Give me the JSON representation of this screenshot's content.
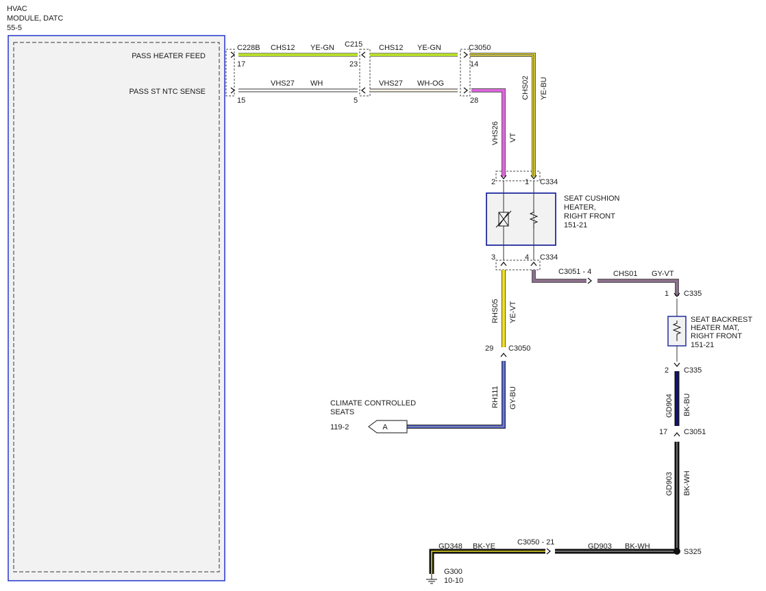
{
  "module": {
    "title_line1": "HVAC",
    "title_line2": "MODULE, DATC",
    "title_line3": "55-5",
    "pin_pass_heater_feed": "PASS HEATER FEED",
    "pin_pass_st_ntc_sense": "PASS ST NTC SENSE"
  },
  "connectors": {
    "c228b": "C228B",
    "c215": "C215",
    "c3050_top": "C3050",
    "c334_top": "C334",
    "c334_bottom": "C334",
    "c3051_4": "C3051  -  4",
    "c335_top": "C335",
    "c335_bottom": "C335",
    "c3050_29": "C3050",
    "c3051_17": "C3051",
    "c3050_21": "C3050  -  21",
    "s325": "S325"
  },
  "pins": {
    "p17": "17",
    "p15": "15",
    "p23": "23",
    "p5": "5",
    "p14": "14",
    "p28": "28",
    "p2": "2",
    "p1": "1",
    "p3": "3",
    "p4": "4",
    "p1_c335": "1",
    "p2_c335": "2",
    "p29": "29",
    "p17_c3051": "17"
  },
  "wires": {
    "w1_circuit": "CHS12",
    "w1_color": "YE-GN",
    "w2_circuit": "CHS12",
    "w2_color": "YE-GN",
    "w3_circuit": "VHS27",
    "w3_color": "WH",
    "w4_circuit": "VHS27",
    "w4_color": "WH-OG",
    "w5_circuit": "CHS02",
    "w5_color": "YE-BU",
    "w6_circuit": "VHS26",
    "w6_color": "VT",
    "w7_circuit": "CHS01",
    "w7_color": "GY-VT",
    "w8_circuit": "RHS05",
    "w8_color": "YE-VT",
    "w9_circuit": "RH111",
    "w9_color": "GY-BU",
    "w10_circuit": "GD904",
    "w10_color": "BK-BU",
    "w11_circuit": "GD903",
    "w11_color": "BK-WH",
    "w12_circuit": "GD348",
    "w12_color": "BK-YE",
    "w13_circuit": "GD903",
    "w13_color": "BK-WH"
  },
  "components": {
    "seat_cushion_l1": "SEAT CUSHION",
    "seat_cushion_l2": "HEATER,",
    "seat_cushion_l3": "RIGHT FRONT",
    "seat_cushion_ref": "151-21",
    "backrest_l1": "SEAT BACKREST",
    "backrest_l2": "HEATER MAT,",
    "backrest_l3": "RIGHT FRONT",
    "backrest_ref": "151-21",
    "climate_l1": "CLIMATE CONTROLLED",
    "climate_l2": "SEATS",
    "climate_ref": "119-2",
    "climate_ref_letter": "A",
    "ground": "G300",
    "ground_ref": "10-10"
  },
  "colors": {
    "module_border": "#2233cc",
    "module_fill": "#f2f2f2",
    "ye_gn": "#b9dd2a",
    "yellow": "#f0e020",
    "violet": "#dd66dd",
    "gray_violet": "#8a6f8a",
    "blue": "#3344aa",
    "dark_blue": "#14146e",
    "black": "#111111",
    "component_border": "#1f2a9e"
  }
}
